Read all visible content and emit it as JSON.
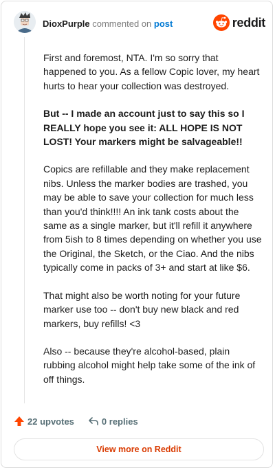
{
  "header": {
    "username": "DioxPurple",
    "action_text": "commented on",
    "post_link": "post",
    "brand_wordmark": "reddit"
  },
  "comment": {
    "paragraphs": [
      {
        "text": "First and foremost, NTA. I'm so sorry that happened to you. As a fellow Copic lover, my heart hurts to hear your collection was destroyed.",
        "bold": false
      },
      {
        "text": "But -- I made an account just to say this so I REALLY hope you see it: ALL HOPE IS NOT LOST! Your markers might be salvageable!!",
        "bold": true
      },
      {
        "text": "Copics are refillable and they make replacement nibs. Unless the marker bodies are trashed, you may be able to save your collection for much less than you'd think!!!! An ink tank costs about the same as a single marker, but it'll refill it anywhere from 5ish to 8 times depending on whether you use the Original, the Sketch, or the Ciao. And the nibs typically come in packs of 3+ and start at like $6.",
        "bold": false
      },
      {
        "text": "That might also be worth noting for your future marker use too -- don't buy new black and red markers, buy refills! <3",
        "bold": false
      },
      {
        "text": "Also -- because they're alcohol-based, plain rubbing alcohol might help take some of the ink of off things.",
        "bold": false
      }
    ]
  },
  "actions": {
    "upvotes_label": "22 upvotes",
    "replies_label": "0 replies"
  },
  "footer": {
    "view_more_label": "View more on Reddit"
  },
  "colors": {
    "brand_orange": "#ff4500",
    "upvote_orange": "#ff4500",
    "link_blue": "#0079d3",
    "view_more_text": "#d93a00"
  },
  "icons": {
    "avatar": "avatar",
    "brand": "reddit-snoo-icon",
    "upvote": "upvote-arrow-icon",
    "reply": "reply-arrow-icon"
  }
}
